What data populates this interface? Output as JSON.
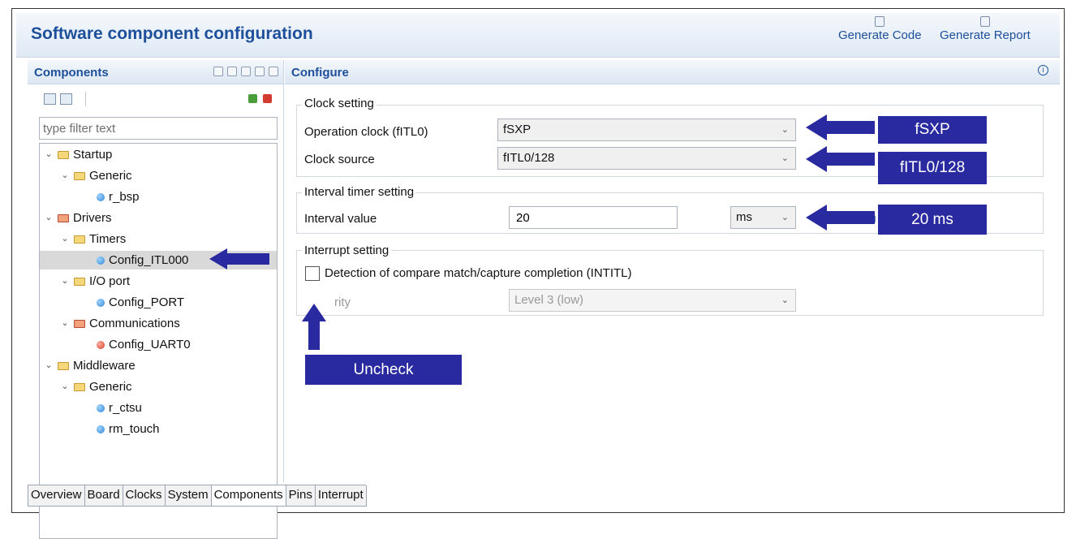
{
  "header": {
    "title": "Software component configuration",
    "generate_code": "Generate Code",
    "generate_report": "Generate Report"
  },
  "components": {
    "title": "Components",
    "filter_placeholder": "type filter text",
    "tree": [
      {
        "label": "Startup",
        "type": "folder"
      },
      {
        "label": "Generic",
        "type": "folder"
      },
      {
        "label": "r_bsp",
        "type": "config"
      },
      {
        "label": "Drivers",
        "type": "folder"
      },
      {
        "label": "Timers",
        "type": "folder"
      },
      {
        "label": "Config_ITL000",
        "type": "config",
        "selected": true
      },
      {
        "label": "I/O port",
        "type": "folder"
      },
      {
        "label": "Config_PORT",
        "type": "config"
      },
      {
        "label": "Communications",
        "type": "folder"
      },
      {
        "label": "Config_UART0",
        "type": "config"
      },
      {
        "label": "Middleware",
        "type": "folder"
      },
      {
        "label": "Generic",
        "type": "folder"
      },
      {
        "label": "r_ctsu",
        "type": "config"
      },
      {
        "label": "rm_touch",
        "type": "config"
      }
    ]
  },
  "configure": {
    "title": "Configure",
    "clock_group": "Clock setting",
    "operation_clock_label": "Operation clock (fITL0)",
    "operation_clock_value": "fSXP",
    "clock_source_label": "Clock source",
    "clock_source_value": "fITL0/128",
    "interval_group": "Interval timer setting",
    "interval_label": "Interval value",
    "interval_value": "20",
    "interval_unit": "ms",
    "interrupt_group": "Interrupt setting",
    "detection_label": "Detection of compare match/capture completion (INTITL)",
    "detection_checked": false,
    "priority_label": "rity",
    "priority_value": "Level 3 (low)",
    "partial_u1": "u",
    "partial_u2": "lu"
  },
  "callouts": {
    "fsxp": "fSXP",
    "fitl": "fITL0/128",
    "interval": "20 ms",
    "uncheck": "Uncheck"
  },
  "tabs": [
    "Overview",
    "Board",
    "Clocks",
    "System",
    "Components",
    "Pins",
    "Interrupt"
  ],
  "colors": {
    "accent": "#1e4f9a",
    "callout": "#2a2aa0"
  }
}
